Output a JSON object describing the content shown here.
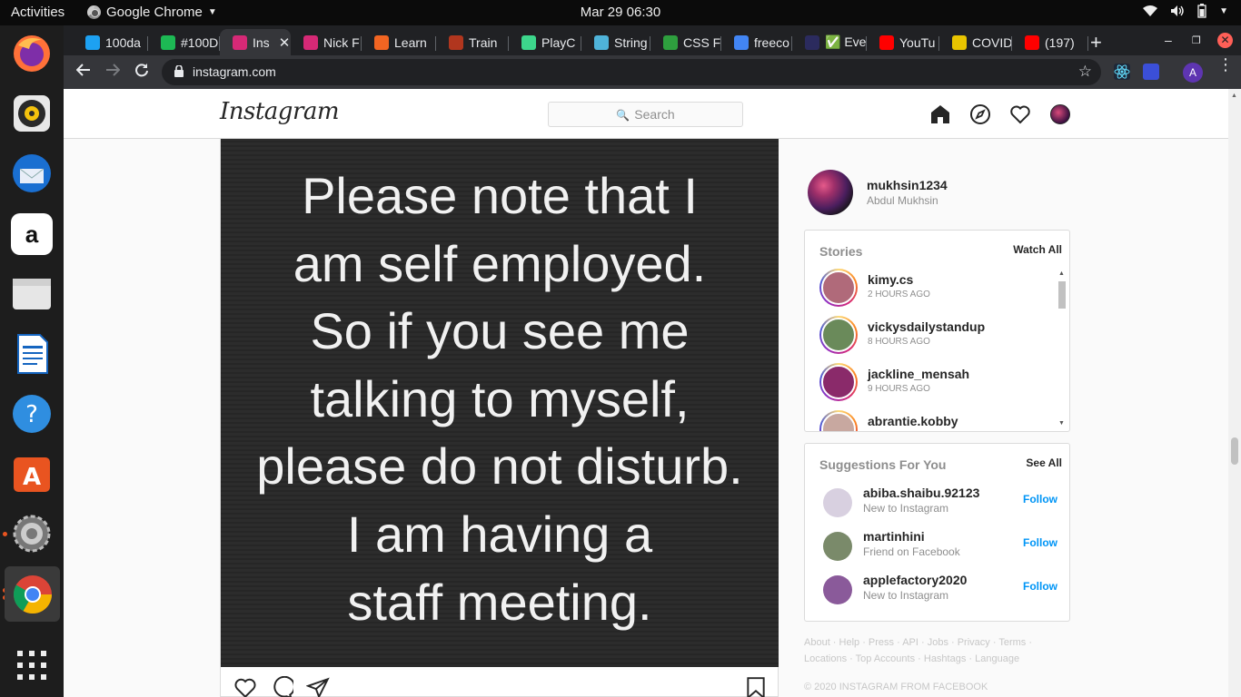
{
  "system_bar": {
    "activities": "Activities",
    "app_name": "Google Chrome",
    "clock": "Mar 29  06:30"
  },
  "dock": {
    "items": [
      "firefox-icon",
      "rhythmbox-icon",
      "thunderbird-icon",
      "amazon-icon",
      "files-icon",
      "writer-icon",
      "help-icon",
      "software-icon",
      "settings-icon",
      "chrome-icon",
      "app-grid-icon"
    ]
  },
  "browser": {
    "tabs": [
      {
        "label": "100da",
        "favicon": "twitter-icon",
        "color": "#1da1f2"
      },
      {
        "label": "#100D",
        "favicon": "100devs-icon",
        "color": "#1db954"
      },
      {
        "label": "Ins",
        "favicon": "instagram-icon",
        "color": "#d62976",
        "active": true
      },
      {
        "label": "Nick F",
        "favicon": "instagram-icon",
        "color": "#d62976"
      },
      {
        "label": "Learn",
        "favicon": "learn-icon",
        "color": "#f26522"
      },
      {
        "label": "Train",
        "favicon": "codewars-icon",
        "color": "#b1361e"
      },
      {
        "label": "PlayC",
        "favicon": "playcode-icon",
        "color": "#3dd68c"
      },
      {
        "label": "String",
        "favicon": "string-icon",
        "color": "#4fb3d9"
      },
      {
        "label": "CSS Fi",
        "favicon": "w3c-icon",
        "color": "#2e9f3e"
      },
      {
        "label": "freeco",
        "favicon": "google-icon",
        "color": "#4285f4"
      },
      {
        "label": "✅ Eve",
        "favicon": "aw-icon",
        "color": "#2b2b5e"
      },
      {
        "label": "YouTu",
        "favicon": "youtube-icon",
        "color": "#ff0000"
      },
      {
        "label": "COVID",
        "favicon": "covid-icon",
        "color": "#e8c400"
      },
      {
        "label": "(197)",
        "favicon": "youtube-icon",
        "color": "#ff0000"
      }
    ],
    "url": "instagram.com"
  },
  "instagram": {
    "logo": "Instagram",
    "search_placeholder": "Search",
    "post": {
      "text_lines": [
        "Please note that I",
        "am self employed.",
        "So if you see me",
        "talking to myself,",
        "please do not disturb.",
        "I am having a",
        "staff meeting."
      ]
    },
    "profile": {
      "username": "mukhsin1234",
      "full_name": "Abdul Mukhsin"
    },
    "stories": {
      "title": "Stories",
      "watch_all": "Watch All",
      "items": [
        {
          "username": "kimy.cs",
          "time": "2 HOURS AGO",
          "color": "#b06a7a"
        },
        {
          "username": "vickysdailystandup",
          "time": "8 HOURS AGO",
          "color": "#6a8a5a"
        },
        {
          "username": "jackline_mensah",
          "time": "9 HOURS AGO",
          "color": "#8a2a6a"
        },
        {
          "username": "abrantie.kobby",
          "time": "",
          "color": "#c8a8a0"
        }
      ]
    },
    "suggestions": {
      "title": "Suggestions For You",
      "see_all": "See All",
      "items": [
        {
          "username": "abiba.shaibu.92123",
          "sub": "New to Instagram",
          "action": "Follow",
          "color": "#d8d0e0"
        },
        {
          "username": "martinhini",
          "sub": "Friend on Facebook",
          "action": "Follow",
          "color": "#7a8a6a"
        },
        {
          "username": "applefactory2020",
          "sub": "New to Instagram",
          "action": "Follow",
          "color": "#8a5a9a"
        }
      ]
    },
    "footer": {
      "links": "About · Help · Press · API · Jobs · Privacy · Terms · Locations · Top Accounts · Hashtags · Language",
      "copyright": "© 2020 INSTAGRAM FROM FACEBOOK"
    }
  },
  "colors": {
    "follow_blue": "#0095f6",
    "chrome_dark": "#202124",
    "ubuntu_orange": "#e95420"
  }
}
